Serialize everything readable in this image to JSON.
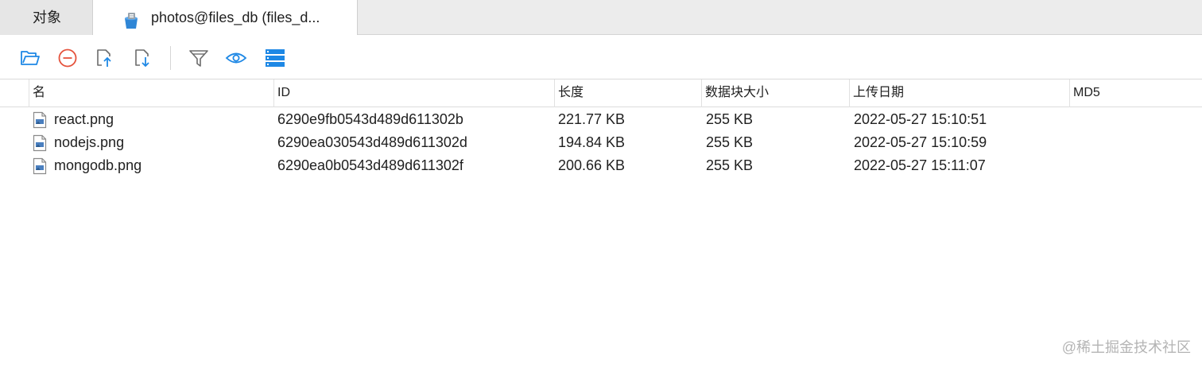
{
  "tabs": [
    {
      "label": "对象"
    },
    {
      "label": "photos@files_db (files_d..."
    }
  ],
  "toolbar": {
    "buttons": [
      {
        "icon": "folder-open-icon"
      },
      {
        "icon": "minus-circle-icon"
      },
      {
        "icon": "upload-file-icon"
      },
      {
        "icon": "download-file-icon"
      },
      {
        "icon": "filter-icon"
      },
      {
        "icon": "eye-icon"
      },
      {
        "icon": "grid-view-icon"
      }
    ],
    "accent_color": "#1e88e5",
    "delete_color": "#e5533d"
  },
  "table": {
    "columns": [
      "名",
      "ID",
      "长度",
      "数据块大小",
      "上传日期",
      "MD5"
    ],
    "rows": [
      {
        "name": "react.png",
        "id": "6290e9fb0543d489d611302b",
        "length": "221.77 KB",
        "chunk": "255 KB",
        "date": "2022-05-27 15:10:51",
        "md5": ""
      },
      {
        "name": "nodejs.png",
        "id": "6290ea030543d489d611302d",
        "length": "194.84 KB",
        "chunk": "255 KB",
        "date": "2022-05-27 15:10:59",
        "md5": ""
      },
      {
        "name": "mongodb.png",
        "id": "6290ea0b0543d489d611302f",
        "length": "200.66 KB",
        "chunk": "255 KB",
        "date": "2022-05-27 15:11:07",
        "md5": ""
      }
    ]
  },
  "watermark": "@稀土掘金技术社区"
}
